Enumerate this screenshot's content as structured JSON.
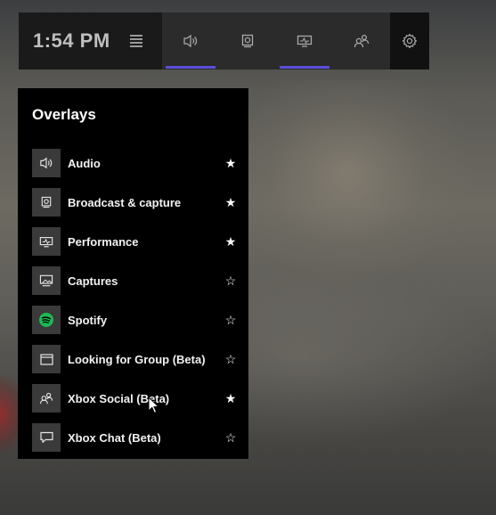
{
  "topbar": {
    "time": "1:54 PM",
    "widgets": [
      {
        "icon": "speaker-icon",
        "active": true
      },
      {
        "icon": "capture-icon",
        "active": false
      },
      {
        "icon": "performance-icon",
        "active": true
      },
      {
        "icon": "social-icon",
        "active": false
      }
    ],
    "settings_icon": "gear-icon"
  },
  "overlays": {
    "title": "Overlays",
    "items": [
      {
        "label": "Audio",
        "icon": "speaker-icon",
        "favorite": true,
        "star": "★"
      },
      {
        "label": "Broadcast & capture",
        "icon": "capture-icon",
        "favorite": true,
        "star": "★"
      },
      {
        "label": "Performance",
        "icon": "performance-icon",
        "favorite": true,
        "star": "★"
      },
      {
        "label": "Captures",
        "icon": "gallery-icon",
        "favorite": false,
        "star": "☆"
      },
      {
        "label": "Spotify",
        "icon": "spotify-icon",
        "favorite": false,
        "star": "☆"
      },
      {
        "label": "Looking for Group (Beta)",
        "icon": "window-icon",
        "favorite": false,
        "star": "☆"
      },
      {
        "label": "Xbox Social (Beta)",
        "icon": "social-icon",
        "favorite": true,
        "star": "★"
      },
      {
        "label": "Xbox Chat (Beta)",
        "icon": "chat-icon",
        "favorite": false,
        "star": "☆"
      }
    ]
  },
  "colors": {
    "accent": "#5b4ed9",
    "spotify": "#1db954",
    "panel_bg": "#000000",
    "bar_bg": "#1a1a1a"
  }
}
